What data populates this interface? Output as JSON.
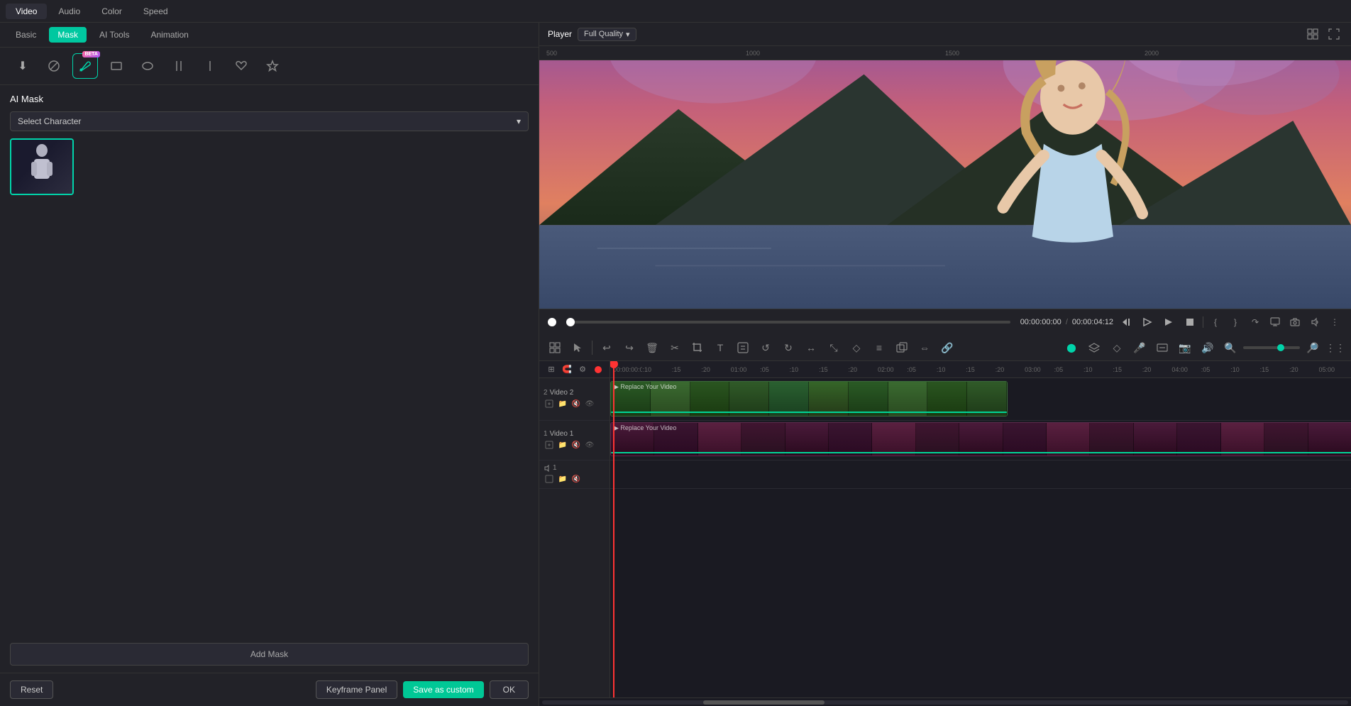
{
  "app": {
    "top_tabs": [
      {
        "id": "video",
        "label": "Video",
        "active": true
      },
      {
        "id": "audio",
        "label": "Audio",
        "active": false
      },
      {
        "id": "color",
        "label": "Color",
        "active": false
      },
      {
        "id": "speed",
        "label": "Speed",
        "active": false
      }
    ]
  },
  "left_panel": {
    "sub_tabs": [
      {
        "id": "basic",
        "label": "Basic",
        "active": false
      },
      {
        "id": "mask",
        "label": "Mask",
        "active": true
      },
      {
        "id": "ai_tools",
        "label": "AI Tools",
        "active": false
      },
      {
        "id": "animation",
        "label": "Animation",
        "active": false
      }
    ],
    "tools": [
      {
        "id": "download",
        "icon": "⬇",
        "label": "download-tool"
      },
      {
        "id": "no",
        "icon": "⊘",
        "label": "no-tool"
      },
      {
        "id": "brush",
        "icon": "✏",
        "label": "brush-tool",
        "active": true,
        "beta": true
      },
      {
        "id": "rectangle",
        "icon": "▭",
        "label": "rectangle-tool"
      },
      {
        "id": "ellipse",
        "icon": "⬭",
        "label": "ellipse-tool"
      },
      {
        "id": "line1",
        "icon": "║",
        "label": "line1-tool"
      },
      {
        "id": "line2",
        "icon": "|",
        "label": "line2-tool"
      },
      {
        "id": "heart",
        "icon": "♡",
        "label": "heart-tool"
      },
      {
        "id": "star",
        "icon": "☆",
        "label": "star-tool"
      }
    ],
    "ai_mask": {
      "title": "AI Mask",
      "select_label": "Select Character",
      "characters": [
        {
          "id": "char1",
          "selected": true
        }
      ]
    },
    "add_mask_label": "Add Mask",
    "actions": {
      "reset_label": "Reset",
      "keyframe_label": "Keyframe Panel",
      "save_custom_label": "Save as custom",
      "ok_label": "OK"
    }
  },
  "player": {
    "label": "Player",
    "quality_label": "Full Quality",
    "current_time": "00:00:00:00",
    "separator": "/",
    "total_time": "00:00:04:12",
    "ruler_marks": [
      "500",
      "1000",
      "1500",
      "2000"
    ]
  },
  "timeline": {
    "tracks": [
      {
        "id": "video2",
        "label": "Video 2",
        "num": "2",
        "type": "video"
      },
      {
        "id": "video1",
        "label": "Video 1",
        "num": "1",
        "type": "video"
      },
      {
        "id": "audio1",
        "label": "Audio 1",
        "num": "1",
        "type": "audio"
      }
    ],
    "time_marks": [
      "00:00:00:05",
      "00:00:00:10",
      "00:00:00:15",
      "00:00:00:20",
      "00:00:01:00",
      "00:00:01:05",
      "00:00:01:10",
      "00:00:01:15",
      "00:00:01:20",
      "00:00:02:00",
      "00:00:02:05",
      "00:00:02:10",
      "00:00:02:15",
      "00:00:02:20",
      "00:00:03:00",
      "00:00:03:05",
      "00:00:03:10",
      "00:00:03:15",
      "00:00:03:20",
      "00:00:04:00",
      "00:00:04:05",
      "00:00:04:10",
      "00:00:04:15",
      "00:00:04:20",
      "00:00:05:00"
    ],
    "clips": [
      {
        "track": "video2",
        "label": "Replace Your Video"
      },
      {
        "track": "video1",
        "label": "Replace Your Video"
      }
    ]
  },
  "colors": {
    "accent_teal": "#00d4aa",
    "accent_green": "#00c896",
    "playhead_red": "#ff3333",
    "beta_pink": "#ff6b9d",
    "beta_purple": "#a855f7",
    "track_green": "#2a5a2a",
    "track_pink": "#5a1a3a"
  }
}
